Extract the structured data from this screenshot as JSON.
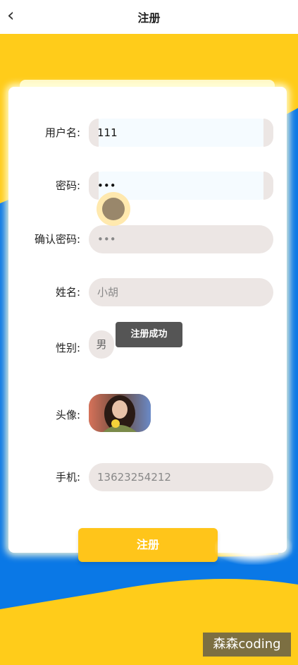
{
  "header": {
    "title": "注册",
    "back_icon": "chevron-left-icon"
  },
  "form": {
    "username": {
      "label": "用户名:",
      "value": "111"
    },
    "password": {
      "label": "密码:",
      "value": "•••"
    },
    "confirm_password": {
      "label": "确认密码:",
      "value": "•••"
    },
    "name": {
      "label": "姓名:",
      "value": "小胡"
    },
    "gender": {
      "label": "性别:",
      "value": "男"
    },
    "avatar": {
      "label": "头像:"
    },
    "phone": {
      "label": "手机:",
      "value": "13623254212"
    }
  },
  "toast": {
    "text": "注册成功"
  },
  "submit_label": "注册",
  "watermark": "森森coding",
  "colors": {
    "accent_yellow": "#ffc51a",
    "accent_blue": "#0a78e6",
    "field_bg": "#ece6e4"
  }
}
